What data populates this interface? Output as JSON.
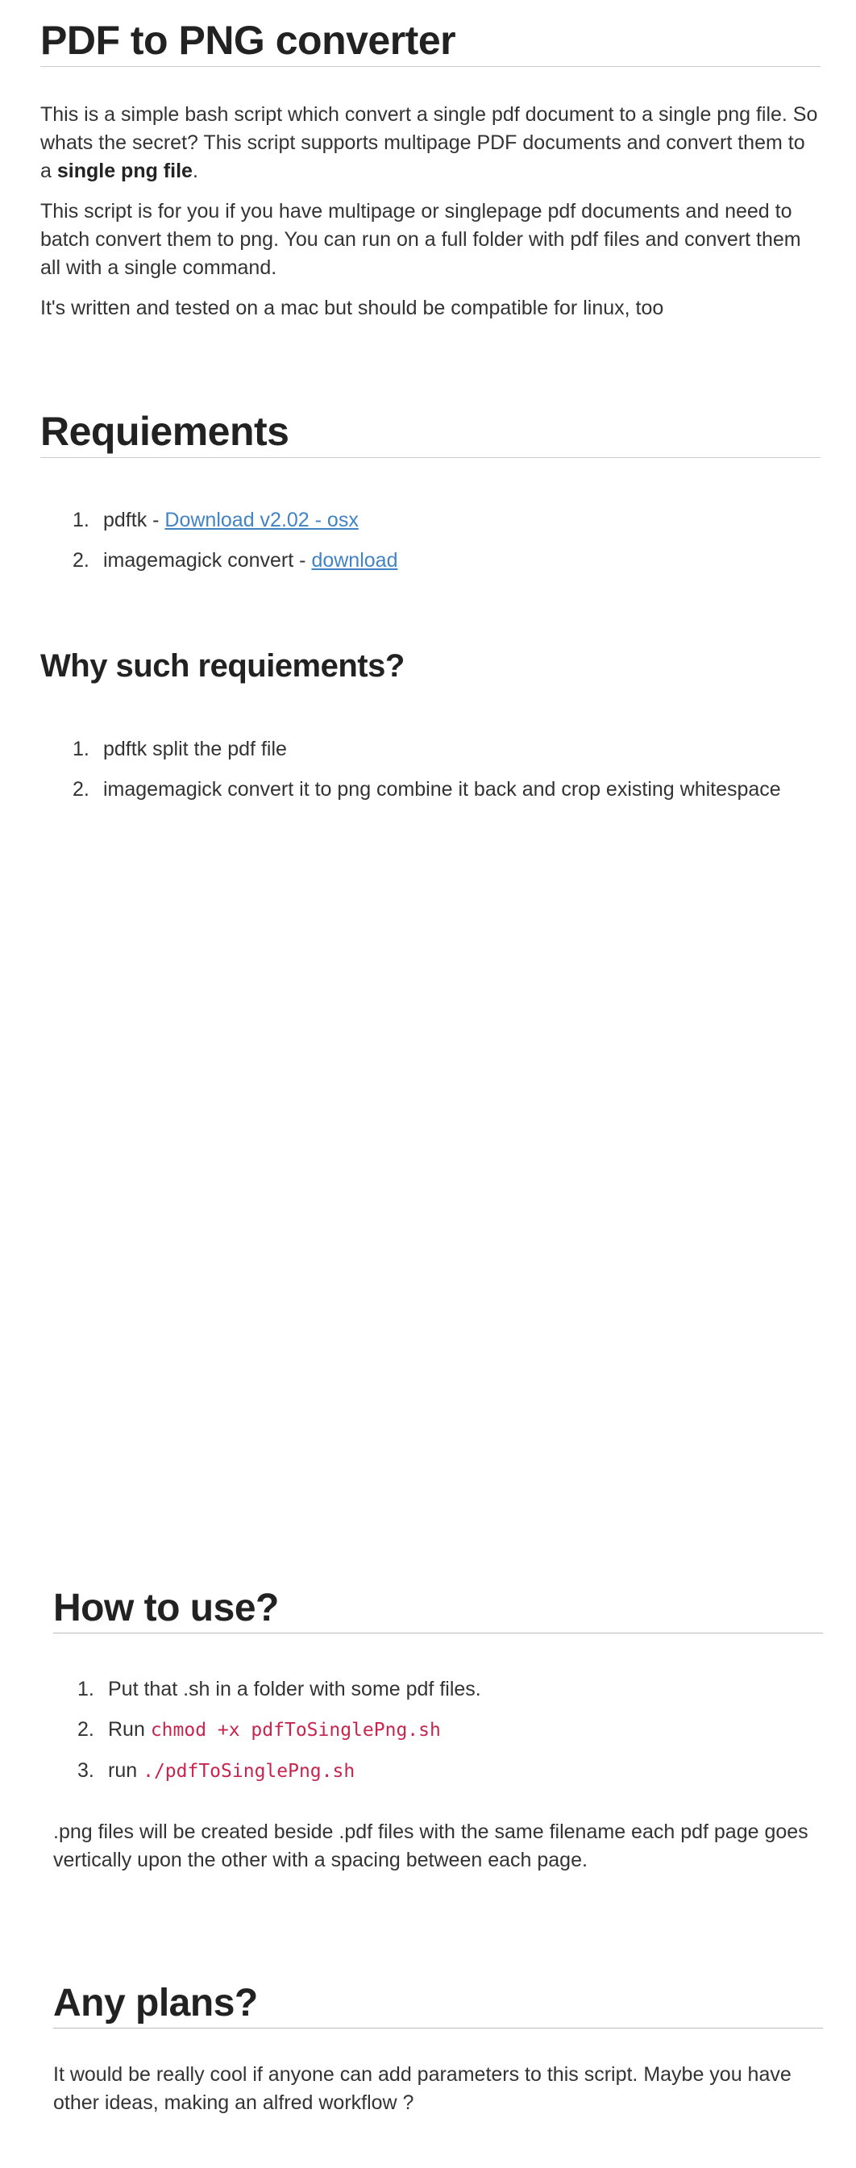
{
  "title": "PDF to PNG converter",
  "intro": {
    "p1_text": "This is a simple bash script which convert a single pdf document to a single png file. So whats the secret? This script supports multipage PDF documents and convert them to a ",
    "p1_bold": "single png file",
    "p1_end": ".",
    "p2": "This script is for you if you have multipage or singlepage pdf documents and need to batch convert them to png. You can run on a full folder with pdf files and convert them all with a single command.",
    "p3": "It's written and tested on a mac but should be compatible for linux, too"
  },
  "requirements": {
    "heading": "Requiements",
    "items": [
      {
        "num": "1.",
        "text": "pdftk - ",
        "link": "Download v2.02 - osx"
      },
      {
        "num": "2.",
        "text": "imagemagick convert - ",
        "link": "download"
      }
    ]
  },
  "why": {
    "heading": "Why such requiements?",
    "items": [
      {
        "num": "1.",
        "text": "pdftk split the pdf file"
      },
      {
        "num": "2.",
        "text": "imagemagick convert it to png combine it back and crop existing whitespace"
      }
    ]
  },
  "how": {
    "heading": "How to use?",
    "items": [
      {
        "num": "1.",
        "text": "Put that .sh in a folder with some pdf files."
      },
      {
        "num": "2.",
        "text": "Run ",
        "code": "chmod +x pdfToSinglePng.sh"
      },
      {
        "num": "3.",
        "text": "run ",
        "code": "./pdfToSinglePng.sh"
      }
    ],
    "after": ".png files will be created beside .pdf files with the same filename each pdf page goes vertically upon the other with a spacing between each page."
  },
  "plans": {
    "heading": "Any plans?",
    "text": "It would be really cool if anyone can add parameters to this script. Maybe you have other ideas, making an alfred workflow ?"
  }
}
